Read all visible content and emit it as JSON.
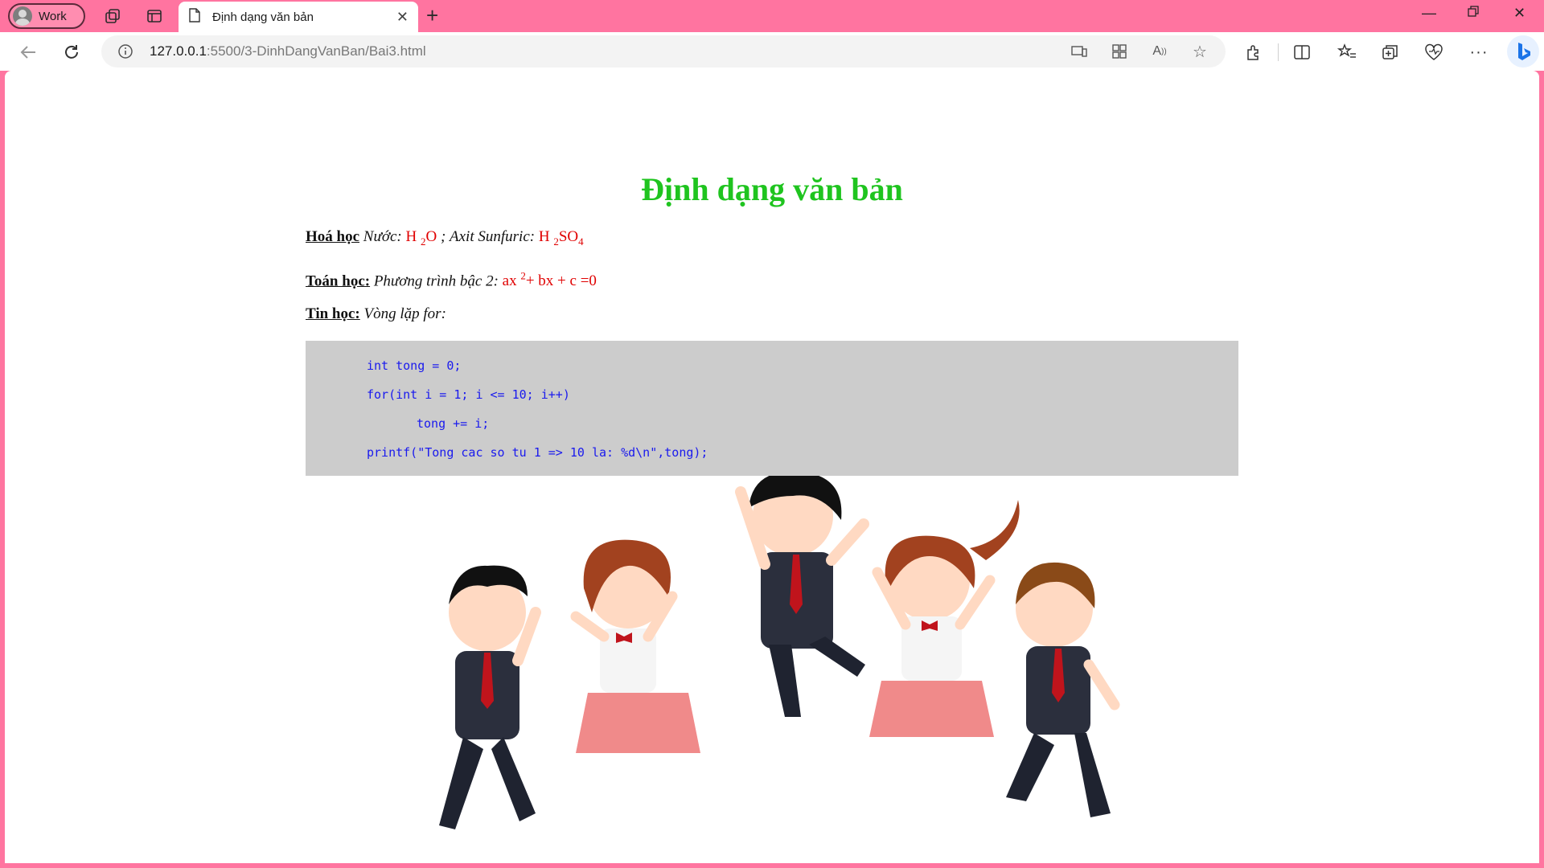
{
  "browser": {
    "profile_label": "Work",
    "tab_title": "Định dạng văn bản",
    "url_host": "127.0.0.1",
    "url_path": ":5500/3-DinhDangVanBan/Bai3.html"
  },
  "page": {
    "title": "Định dạng văn bản",
    "chem": {
      "subject": "Hoá học",
      "water_label": "Nước:",
      "water_H": "H",
      "water_sub": "2",
      "water_O": "O",
      "sep": ";",
      "acid_label": "Axit Sunfuric:",
      "acid_H": "H",
      "acid_sub1": "2",
      "acid_SO": "SO",
      "acid_sub2": "4"
    },
    "math": {
      "subject": "Toán học:",
      "label": "Phương trình bậc 2:",
      "ax": "ax",
      "sup": "2",
      "rest": "+ bx + c =0"
    },
    "cs": {
      "subject": "Tin học:",
      "label": "Vòng lặp for:"
    },
    "code": [
      "int tong = 0;",
      "for(int i = 1; i <= 10; i++)",
      "tong += i;",
      "printf(\"Tong cac so tu 1 => 10 la: %d\\n\",tong);"
    ]
  },
  "colors": {
    "title": "#1fc41f",
    "formula": "#e00000",
    "code_text": "#1a1aee",
    "code_bg": "#cccccc",
    "chrome": "#ff74a0"
  }
}
